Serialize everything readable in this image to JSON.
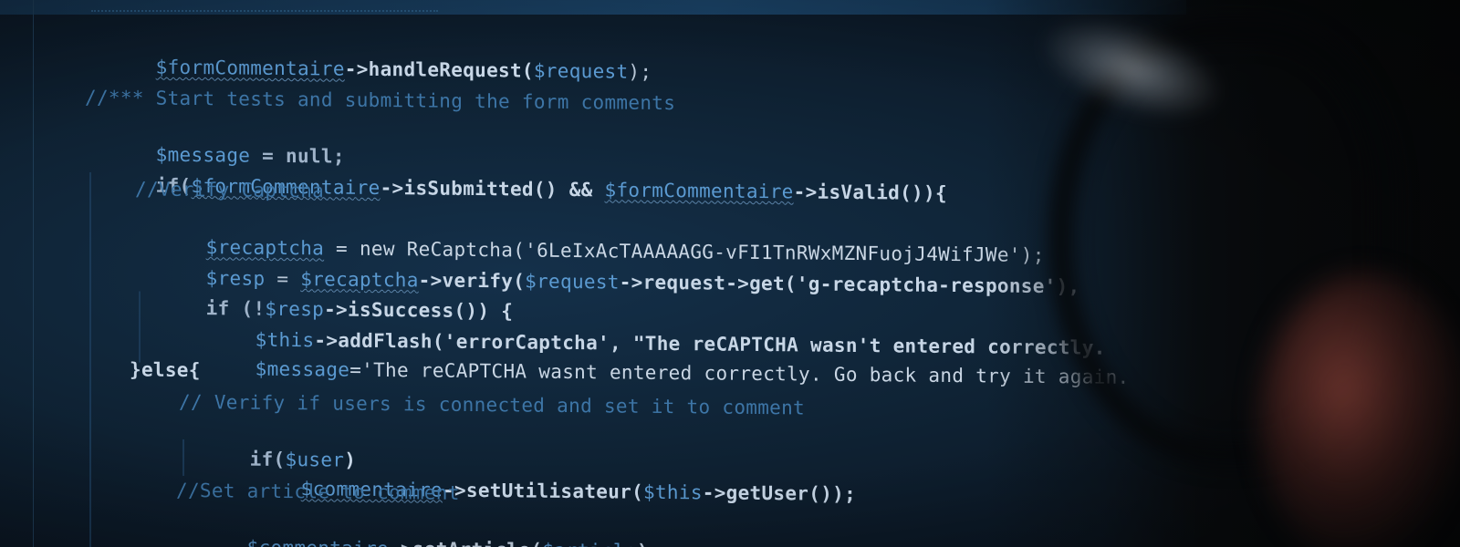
{
  "code_lines": [
    {
      "var": "$formCommentaire",
      "rest": "->handleRequest(",
      "arg": "$request",
      "end": ");"
    },
    {
      "comment": "//*** Start tests and submitting the form comments"
    },
    {
      "var": "$message",
      "rest": " = null;"
    },
    {
      "pre": "if(",
      "var1": "$formCommentaire",
      "mid": "->isSubmitted() && ",
      "var2": "$formCommentaire",
      "end": "->isValid()){"
    },
    {
      "comment": "//Verify Captcha"
    },
    {
      "var": "$recaptcha",
      "rest": " = new ReCaptcha('6LeIxAcTAAAAAGG-vFI1TnRWxMZNFuojJ4WifJWe');"
    },
    {
      "var": "$resp",
      "mid": " = ",
      "var2": "$recaptcha",
      "rest": "->verify(",
      "arg": "$request",
      "end": "->request->get('g-recaptcha-response'),"
    },
    {
      "pre": "if (!",
      "var": "$resp",
      "end": "->isSuccess()) {"
    },
    {
      "var": "$this",
      "rest": "->addFlash('errorCaptcha', \"The reCAPTCHA wasn't entered correctly."
    },
    {
      "var": "$message",
      "rest": "='The reCAPTCHA wasnt entered correctly. Go back and try it again."
    },
    {
      "text": "}else{"
    },
    {
      "comment": "// Verify if users is connected and set it to comment"
    },
    {
      "pre": "if(",
      "var": "$user",
      "end": ")"
    },
    {
      "var": "$commentaire",
      "rest": "->setUtilisateur(",
      "arg": "$this",
      "end": "->getUser());"
    },
    {
      "comment": "//Set article to comment"
    },
    {
      "var": "$commentaire",
      "rest": "->setArticle(",
      "arg": "$article",
      "end": ");"
    }
  ]
}
